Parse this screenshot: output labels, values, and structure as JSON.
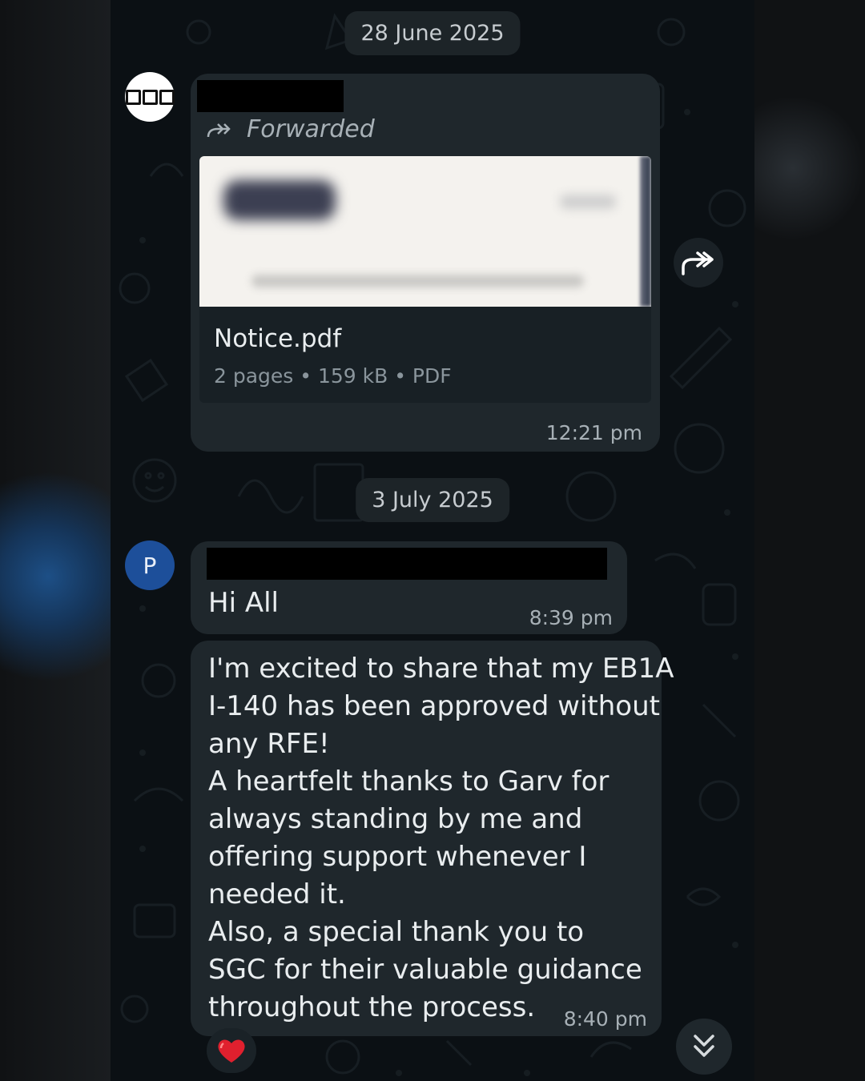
{
  "date_separators": [
    "28 June 2025",
    "3 July 2025"
  ],
  "message1": {
    "sender_avatar_icon": "sgc-logo-icon",
    "forwarded_label": "Forwarded",
    "document": {
      "name": "Notice.pdf",
      "meta": "2 pages • 159 kB • PDF"
    },
    "time": "12:21 pm",
    "share_icon": "forward-share-icon"
  },
  "message2": {
    "avatar_letter": "P",
    "text": "Hi All",
    "time": "8:39 pm"
  },
  "message3": {
    "lines": [
      "I'm excited to share that my EB1A",
      "I-140 has been approved without",
      "any RFE!",
      "A heartfelt thanks to Garv for",
      "always standing by me and",
      "offering support whenever I",
      "needed it.",
      "Also, a special thank you to",
      "SGC for their valuable guidance",
      "throughout the process."
    ],
    "time": "8:40 pm",
    "reaction_icon": "red-heart-icon"
  },
  "scroll_button_icon": "double-chevron-down-icon",
  "colors": {
    "chat_background": "#0b1014",
    "bubble": "#1f272c",
    "text": "#e9edef",
    "muted_text": "#a7b0b6",
    "avatar_p": "#1d4f9a",
    "heart": "#e0202e"
  }
}
